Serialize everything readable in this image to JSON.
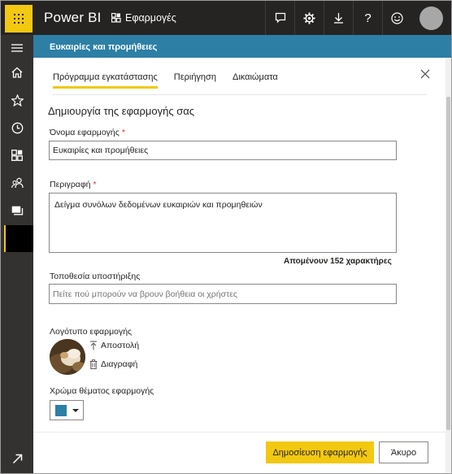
{
  "topbar": {
    "brand": "Power BI",
    "apps_label": "Εφαρμογές",
    "icons": [
      "waffle-icon",
      "apps-icon",
      "feedback-icon",
      "gear-icon",
      "download-icon",
      "help-icon",
      "smiley-icon",
      "avatar"
    ],
    "help_glyph": "?"
  },
  "leftnav": {
    "icons": [
      "hamburger-icon",
      "home-icon",
      "star-icon",
      "clock-icon",
      "apps-grid-icon",
      "shared-icon",
      "workspaces-icon",
      "expand-icon"
    ]
  },
  "app_header": {
    "title": "Ευκαιρίες και προμήθειες"
  },
  "tabs": [
    {
      "label": "Πρόγραμμα εγκατάστασης",
      "active": true
    },
    {
      "label": "Περιήγηση",
      "active": false
    },
    {
      "label": "Δικαιώματα",
      "active": false
    }
  ],
  "form": {
    "heading": "Δημιουργία της εφαρμογής σας",
    "name_label": "Όνομα εφαρμογής",
    "name_value": "Ευκαιρίες και προμήθειες",
    "required_mark": "*",
    "description_label": "Περιγραφή",
    "description_value": "Δείγμα συνόλων δεδομένων ευκαιριών και προμηθειών",
    "chars_left": "Απομένουν 152 χαρακτήρες",
    "support_label": "Τοποθεσία υποστήριξης",
    "support_placeholder": "Πείτε πού μπορούν να βρουν βοήθεια οι χρήστες",
    "logo_label": "Λογότυπο εφαρμογής",
    "upload_label": "Αποστολή",
    "delete_label": "Διαγραφή",
    "theme_label": "Χρώμα θέματος εφαρμογής",
    "theme_color": "#2d7fa5"
  },
  "buttons": {
    "publish": "Δημοσίευση εφαρμογής",
    "cancel": "Άκυρο"
  },
  "colors": {
    "accent": "#f2c811",
    "header": "#2d7fa5",
    "topbar": "#252423",
    "leftnav": "#333231"
  }
}
